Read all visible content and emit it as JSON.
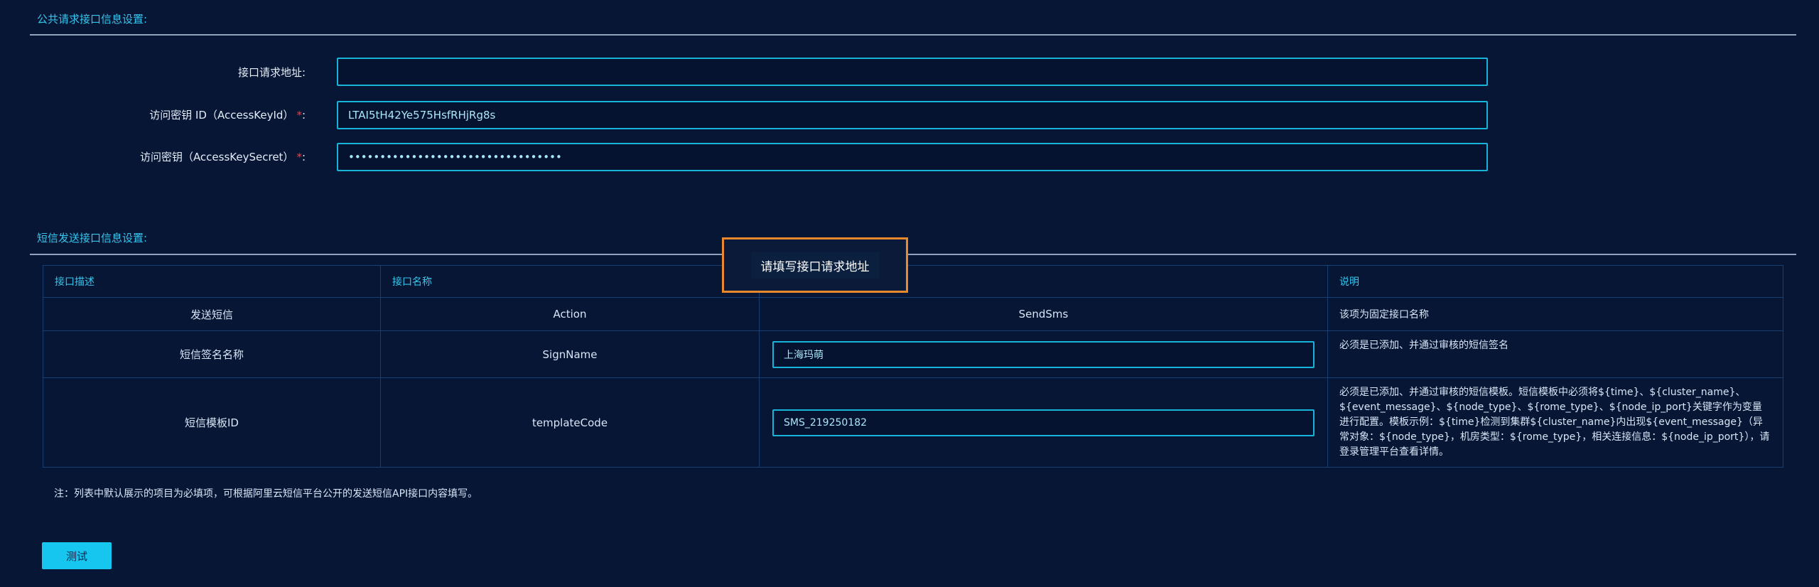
{
  "common_section": {
    "title": "公共请求接口信息设置:",
    "fields": [
      {
        "label": "接口请求地址:",
        "required": false,
        "value": ""
      },
      {
        "label": "访问密钥 ID（AccessKeyId）",
        "required": true,
        "suffix": ":",
        "value": "LTAI5tH42Ye575HsfRHjRg8s"
      },
      {
        "label": "访问密钥（AccessKeySecret）",
        "required": true,
        "suffix": ":",
        "value": "••••••••••••••••••••••••••••••••••"
      }
    ]
  },
  "sms_section": {
    "title": "短信发送接口信息设置:",
    "columns": [
      "接口描述",
      "接口名称",
      "参",
      "说明"
    ],
    "rows": [
      {
        "desc": "发送短信",
        "name": "Action",
        "param": "SendSms",
        "note": "该项为固定接口名称"
      },
      {
        "desc": "短信签名名称",
        "name": "SignName",
        "param": "上海玛萌",
        "note": "必须是已添加、并通过审核的短信签名"
      },
      {
        "desc": "短信模板ID",
        "name": "templateCode",
        "param": "SMS_219250182",
        "note": "必须是已添加、并通过审核的短信模板。短信模板中必须将${time}、${cluster_name}、${event_message}、${node_type}、${rome_type}、${node_ip_port}关键字作为变量进行配置。模板示例：${time}检测到集群${cluster_name}内出现${event_message}（异常对象：${node_type}，机房类型：${rome_type}，相关连接信息：${node_ip_port}），请登录管理平台查看详情。"
      }
    ],
    "footnote": "注：列表中默认展示的项目为必填项，可根据阿里云短信平台公开的发送短信API接口内容填写。",
    "required_mark": "*"
  },
  "test_button": {
    "label": "测试"
  },
  "tooltip": {
    "text": "请填写接口请求地址"
  }
}
